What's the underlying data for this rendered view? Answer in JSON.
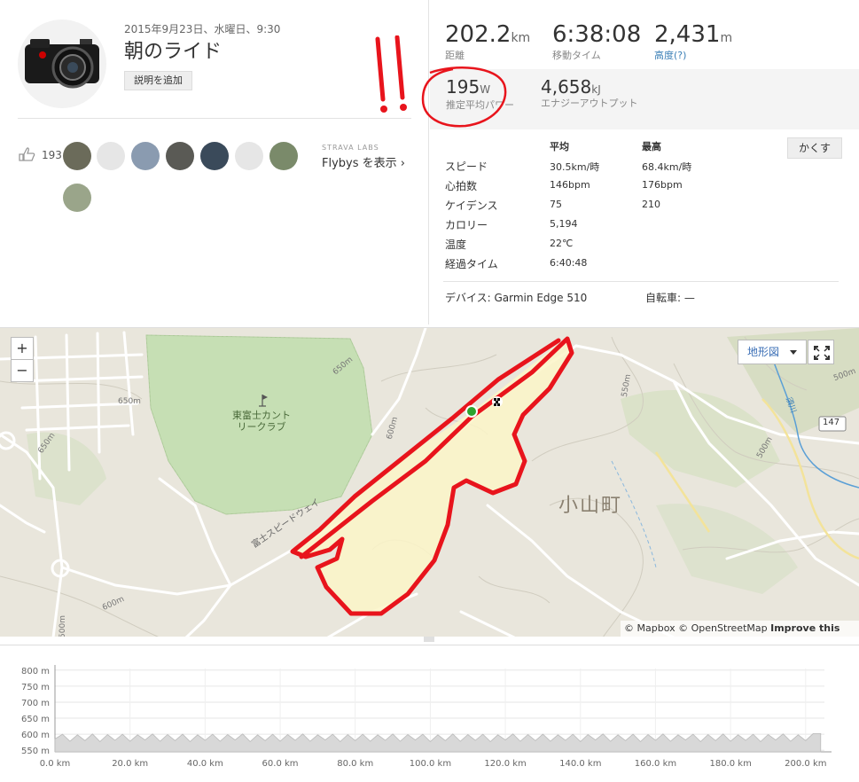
{
  "activity": {
    "date": "2015年9月23日、水曜日、9:30",
    "title": "朝のライド",
    "add_description": "説明を追加",
    "annotation_text": "!!"
  },
  "social": {
    "kudos_count": "193",
    "strava_labs": "STRAVA LABS",
    "flybys": "Flybys を表示 ›"
  },
  "stats": {
    "distance": {
      "value": "202.2",
      "unit": "km",
      "label": "距離"
    },
    "moving_time": {
      "value": "6:38:08",
      "label": "移動タイム"
    },
    "elevation": {
      "value": "2,431",
      "unit": "m",
      "label": "高度",
      "help": "(?)"
    },
    "power": {
      "value": "195",
      "unit": "W",
      "label": "推定平均パワー"
    },
    "energy": {
      "value": "4,658",
      "unit": "kJ",
      "label": "エナジーアウトプット"
    }
  },
  "details": {
    "hide_label": "かくす",
    "headers": {
      "avg": "平均",
      "max": "最高"
    },
    "rows": [
      {
        "label": "スピード",
        "avg": "30.5km/時",
        "max": "68.4km/時"
      },
      {
        "label": "心拍数",
        "avg": "146bpm",
        "max": "176bpm"
      },
      {
        "label": "ケイデンス",
        "avg": "75",
        "max": "210"
      },
      {
        "label": "カロリー",
        "avg": "5,194",
        "max": ""
      },
      {
        "label": "温度",
        "avg": "22℃",
        "max": ""
      },
      {
        "label": "経過タイム",
        "avg": "6:40:48",
        "max": ""
      }
    ],
    "device": "デバイス: Garmin Edge 510",
    "bike": "自転車: —"
  },
  "map": {
    "zoom_in": "+",
    "zoom_out": "−",
    "map_type": "地形図",
    "attribution_prefix": "© Mapbox © OpenStreetMap ",
    "attribution_link": "Improve this map",
    "labels": {
      "country_club": "東富士カント\nリークラブ",
      "town": "小山町",
      "speedway": "富士スピードウェイ",
      "road_number": "147",
      "c650a": "650m",
      "c650b": "650m",
      "c650c": "650m",
      "c600a": "600m",
      "c600b": "600m",
      "c550": "550m",
      "c500a": "500m",
      "c500b": "500m",
      "c500c": "500m",
      "river": "須川"
    },
    "colors": {
      "route": "#e8141c",
      "start": "#2ea32e",
      "land": "#e9e6dc",
      "park": "#c6dfb4"
    }
  },
  "chart_data": {
    "type": "area",
    "title": "",
    "xlabel": "",
    "ylabel": "",
    "x_unit": "km",
    "y_unit": "m",
    "xlim": [
      0,
      205
    ],
    "ylim": [
      545,
      805
    ],
    "x_ticks": [
      "0.0 km",
      "20.0 km",
      "40.0 km",
      "60.0 km",
      "80.0 km",
      "100.0 km",
      "120.0 km",
      "140.0 km",
      "160.0 km",
      "180.0 km",
      "200.0 km"
    ],
    "y_ticks": [
      "800 m",
      "750 m",
      "700 m",
      "650 m",
      "600 m",
      "550 m"
    ],
    "series": [
      {
        "values_description": "repeating laps",
        "x": [
          0,
          2,
          4,
          6,
          8,
          10,
          12,
          14,
          16,
          18,
          20,
          22,
          24,
          26,
          28,
          30,
          32,
          34,
          36,
          38,
          40,
          42,
          44,
          46,
          48,
          50,
          52,
          54,
          56,
          58,
          60,
          62,
          64,
          66,
          68,
          70,
          72,
          74,
          76,
          78,
          80,
          82,
          84,
          86,
          88,
          90,
          92,
          94,
          96,
          98,
          100,
          102,
          104,
          106,
          108,
          110,
          112,
          114,
          116,
          118,
          120,
          122,
          124,
          126,
          128,
          130,
          132,
          134,
          136,
          138,
          140,
          142,
          144,
          146,
          148,
          150,
          152,
          154,
          156,
          158,
          160,
          162,
          164,
          166,
          168,
          170,
          172,
          174,
          176,
          178,
          180,
          182,
          184,
          186,
          188,
          190,
          192,
          194,
          196,
          198,
          200,
          202,
          204
        ],
        "y": [
          585,
          600,
          578,
          598,
          580,
          601,
          577,
          599,
          581,
          600,
          578,
          598,
          582,
          601,
          578,
          599,
          580,
          600,
          577,
          598,
          581,
          600,
          578,
          599,
          582,
          601,
          577,
          598,
          580,
          600,
          578,
          599,
          581,
          601,
          578,
          598,
          582,
          600,
          577,
          599,
          580,
          600,
          578,
          598,
          581,
          601,
          578,
          599,
          582,
          600,
          577,
          598,
          580,
          601,
          578,
          599,
          581,
          600,
          577,
          598,
          582,
          601,
          578,
          599,
          580,
          600,
          578,
          598,
          581,
          600,
          577,
          599,
          582,
          601,
          578,
          598,
          580,
          600,
          577,
          599,
          581,
          601,
          578,
          598,
          582,
          600,
          577,
          599,
          580,
          601,
          578,
          598,
          581,
          600,
          577,
          599,
          582,
          601,
          578,
          598,
          580,
          602,
          602
        ]
      }
    ],
    "grid": true,
    "colors": {
      "fill": "#d8d8d8",
      "line": "#bbbbbb"
    }
  }
}
